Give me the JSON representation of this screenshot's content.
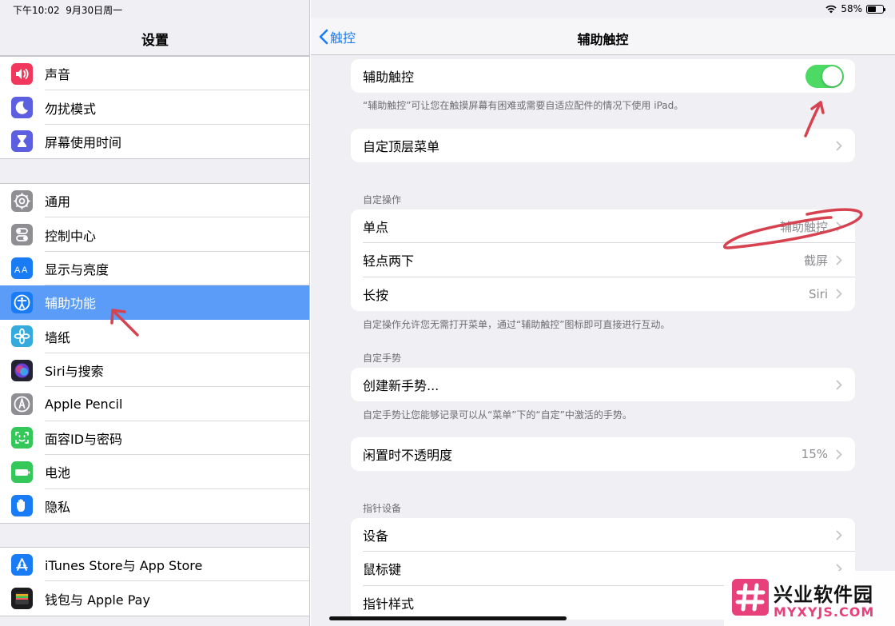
{
  "status": {
    "time": "下午10:02",
    "date": "9月30日周一",
    "battery": "58%",
    "battery_level": 0.58
  },
  "sidebar": {
    "title": "设置",
    "groups": [
      {
        "items": [
          {
            "label": "声音",
            "icon": "speaker-icon",
            "color": "#f2375c"
          },
          {
            "label": "勿扰模式",
            "icon": "moon-icon",
            "color": "#5b5fe0"
          },
          {
            "label": "屏幕使用时间",
            "icon": "hourglass-icon",
            "color": "#5b5fe0"
          }
        ]
      },
      {
        "items": [
          {
            "label": "通用",
            "icon": "gear-icon",
            "color": "#8e8e93"
          },
          {
            "label": "控制中心",
            "icon": "toggles-icon",
            "color": "#8e8e93"
          },
          {
            "label": "显示与亮度",
            "icon": "text-size-icon",
            "color": "#1a7cf5"
          },
          {
            "label": "辅助功能",
            "icon": "accessibility-icon",
            "color": "#1a7cf5",
            "selected": true
          },
          {
            "label": "墙纸",
            "icon": "flower-icon",
            "color": "#35aadc"
          },
          {
            "label": "Siri与搜索",
            "icon": "siri-icon",
            "color": "#222233"
          },
          {
            "label": "Apple Pencil",
            "icon": "pencil-icon",
            "color": "#8e8e93"
          },
          {
            "label": "面容ID与密码",
            "icon": "face-id-icon",
            "color": "#34c759"
          },
          {
            "label": "电池",
            "icon": "battery-icon",
            "color": "#34c759"
          },
          {
            "label": "隐私",
            "icon": "hand-icon",
            "color": "#1a7cf5"
          }
        ]
      },
      {
        "items": [
          {
            "label": "iTunes Store与 App Store",
            "icon": "app-store-icon",
            "color": "#1a7cf5"
          },
          {
            "label": "钱包与 Apple Pay",
            "icon": "wallet-icon",
            "color": "#1c1c1e"
          }
        ]
      }
    ]
  },
  "nav": {
    "back_label": "触控",
    "title": "辅助触控"
  },
  "main": {
    "toggle_row": {
      "label": "辅助触控",
      "on": true
    },
    "toggle_footnote": "“辅助触控”可让您在触摸屏幕有困难或需要自适应配件的情况下使用 iPad。",
    "top_menu": {
      "label": "自定顶层菜单"
    },
    "custom_actions": {
      "header": "自定操作",
      "rows": [
        {
          "label": "单点",
          "value": "辅助触控"
        },
        {
          "label": "轻点两下",
          "value": "截屏"
        },
        {
          "label": "长按",
          "value": "Siri"
        }
      ],
      "footnote": "自定操作允许您无需打开菜单，通过“辅助触控”图标即可直接进行互动。"
    },
    "custom_gestures": {
      "header": "自定手势",
      "row": {
        "label": "创建新手势..."
      },
      "footnote": "自定手势让您能够记录可以从“菜单”下的“自定”中激活的手势。"
    },
    "idle_opacity": {
      "label": "闲置时不透明度",
      "value": "15%"
    },
    "pointer_devices": {
      "header": "指针设备",
      "rows": [
        {
          "label": "设备"
        },
        {
          "label": "鼠标键"
        },
        {
          "label": "指针样式"
        }
      ]
    }
  },
  "watermark": {
    "text_cn": "兴业软件园",
    "text_en": "MYXYJS.COM"
  },
  "colors": {
    "accent": "#1a7cf5",
    "selected_row": "#5a9cf8",
    "toggle_on": "#4cd964",
    "annotation": "#d6424f"
  }
}
